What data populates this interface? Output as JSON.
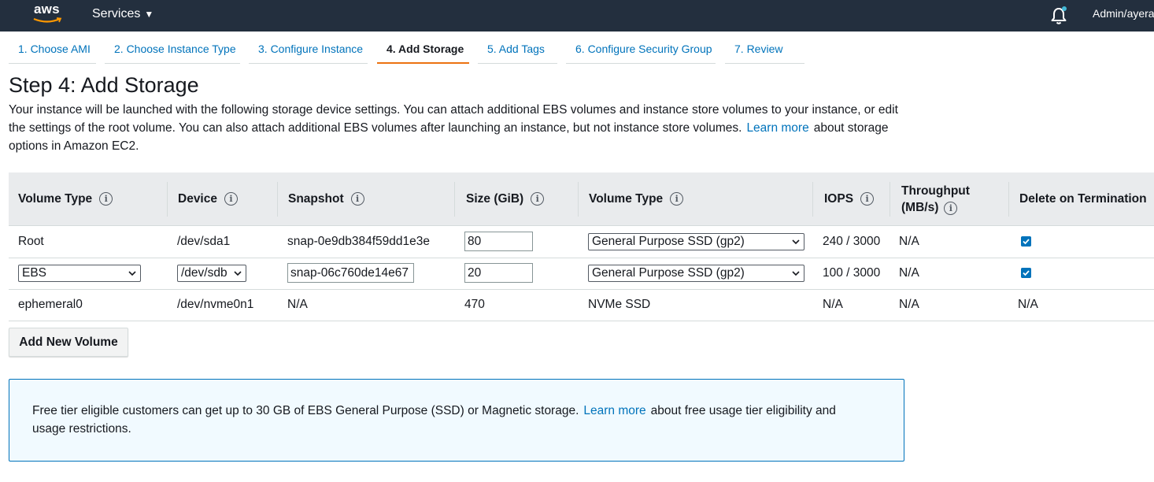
{
  "topbar": {
    "logo_text": "aws",
    "services_label": "Services",
    "user_label": "Admin/ayera"
  },
  "tabs": [
    {
      "label": "1. Choose AMI"
    },
    {
      "label": "2. Choose Instance Type"
    },
    {
      "label": "3. Configure Instance"
    },
    {
      "label": "4. Add Storage",
      "active": true
    },
    {
      "label": "5. Add Tags"
    },
    {
      "label": "6. Configure Security Group"
    },
    {
      "label": "7. Review"
    }
  ],
  "page": {
    "title": "Step 4: Add Storage",
    "desc_main": "Your instance will be launched with the following storage device settings. You can attach additional EBS volumes and instance store volumes to your instance, or edit the settings of the root volume. You can also attach additional EBS volumes after launching an instance, but not instance store volumes.",
    "desc_link": "Learn more",
    "desc_tail": "about storage options in Amazon EC2."
  },
  "table": {
    "headers": {
      "volume_type": "Volume Type",
      "device": "Device",
      "snapshot": "Snapshot",
      "size": "Size (GiB)",
      "volume_type2": "Volume Type",
      "iops": "IOPS",
      "throughput_1": "Throughput",
      "throughput_2": "(MB/s)",
      "delete": "Delete on Termination"
    },
    "info_icon_glyph": "i",
    "rows": [
      {
        "volume_type": "Root",
        "device": "/dev/sda1",
        "snapshot": "snap-0e9db384f59dd1e3e",
        "size": "80",
        "type": "General Purpose SSD (gp2)",
        "iops": "240 / 3000",
        "throughput": "N/A",
        "delete_checked": true
      },
      {
        "volume_type": "EBS",
        "device": "/dev/sdb",
        "snapshot": "snap-06c760de14e67",
        "size": "20",
        "type": "General Purpose SSD (gp2)",
        "iops": "100 / 3000",
        "throughput": "N/A",
        "delete_checked": true
      },
      {
        "volume_type": "ephemeral0",
        "device": "/dev/nvme0n1",
        "snapshot": "N/A",
        "size": "470",
        "type": "NVMe SSD",
        "iops": "N/A",
        "throughput": "N/A",
        "delete": "N/A"
      }
    ]
  },
  "add_volume_label": "Add New Volume",
  "alert": {
    "text_main": "Free tier eligible customers can get up to 30 GB of EBS General Purpose (SSD) or Magnetic storage.",
    "link": "Learn more",
    "text_tail": "about free usage tier eligibility and usage restrictions."
  },
  "colors": {
    "topbar_bg": "#232f3e",
    "link": "#0073bb",
    "active_tab_underline": "#ec7211",
    "header_bg": "#e9ebed",
    "alert_border": "#0073bb",
    "alert_bg": "#f1faff"
  },
  "icons": {
    "bell": "notification-bell-icon",
    "caret": "caret-down-icon",
    "info": "info-icon",
    "chevron": "chevron-down-icon",
    "check": "checkbox-checked-icon"
  }
}
